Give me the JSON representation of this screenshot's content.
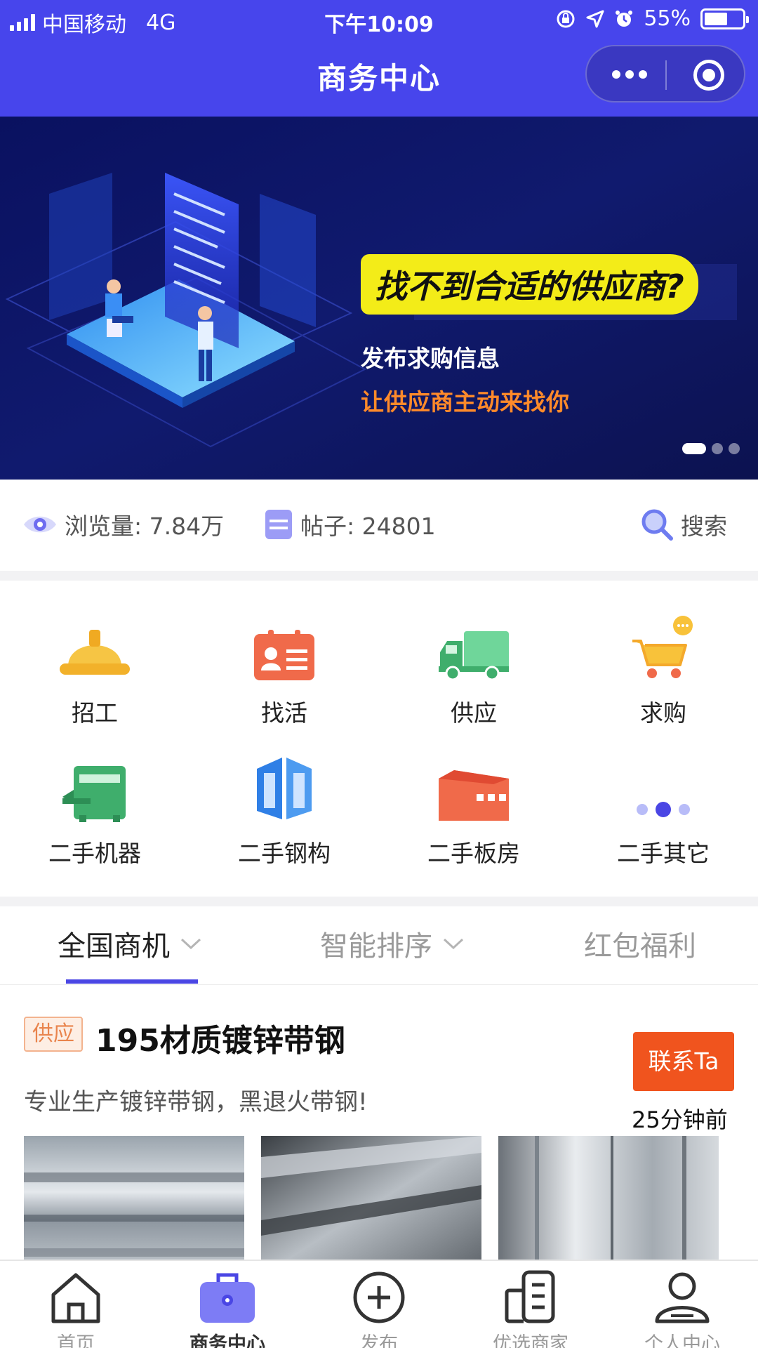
{
  "status_bar": {
    "carrier": "中国移动",
    "network": "4G",
    "time": "下午10:09",
    "battery": "55%",
    "battery_level": 0.55
  },
  "nav": {
    "title": "商务中心"
  },
  "banner": {
    "tagline": "找不到合适的供应商?",
    "line1": "发布求购信息",
    "line2": "让供应商主动来找你",
    "page_count": 3,
    "active_page": 1
  },
  "stats": {
    "views": "浏览量: 7.84万",
    "posts": "帖子: 24801",
    "search": "搜索"
  },
  "categories": [
    {
      "label": "招工",
      "icon": "hardhat-icon"
    },
    {
      "label": "找活",
      "icon": "id-card-icon"
    },
    {
      "label": "供应",
      "icon": "truck-icon"
    },
    {
      "label": "求购",
      "icon": "shopping-cart-icon"
    },
    {
      "label": "二手机器",
      "icon": "machine-icon"
    },
    {
      "label": "二手钢构",
      "icon": "steel-structure-icon"
    },
    {
      "label": "二手板房",
      "icon": "prefab-house-icon"
    },
    {
      "label": "二手其它",
      "icon": "more-dots-icon"
    }
  ],
  "tabs": [
    {
      "label": "全国商机",
      "active": true
    },
    {
      "label": "智能排序",
      "active": false
    },
    {
      "label": "红包福利",
      "active": false
    }
  ],
  "post": {
    "badge": "供应",
    "title": "195材质镀锌带钢",
    "description": "专业生产镀锌带钢，黑退火带钢!",
    "contact": "联系Ta",
    "time_ago": "25分钟前"
  },
  "tabbar": [
    {
      "label": "首页",
      "icon": "home-icon",
      "active": false
    },
    {
      "label": "商务中心",
      "icon": "briefcase-icon",
      "active": true
    },
    {
      "label": "发布",
      "icon": "plus-circle-icon",
      "active": false
    },
    {
      "label": "优选商家",
      "icon": "shop-icon",
      "active": false
    },
    {
      "label": "个人中心",
      "icon": "user-icon",
      "active": false
    }
  ],
  "colors": {
    "brand": "#4745ec",
    "accent_orange": "#f0541e",
    "banner_yellow": "#f3ec18"
  }
}
